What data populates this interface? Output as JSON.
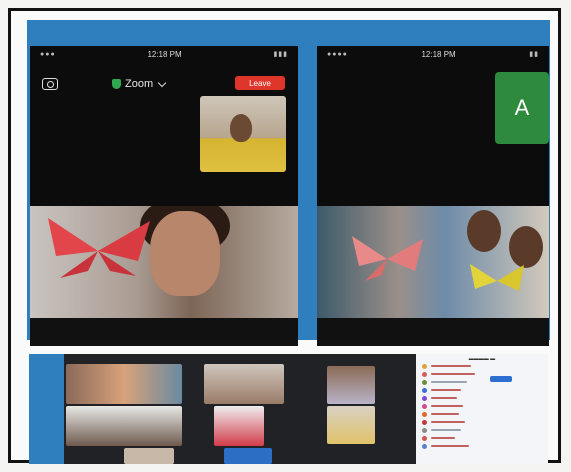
{
  "left_phone": {
    "status_time": "12:18 PM",
    "meeting_title": "Zoom",
    "leave_label": "Leave"
  },
  "right_phone": {
    "status_time": "12:18 PM",
    "avatar_letter": "A"
  },
  "colors": {
    "collage_border": "#2f7fbe",
    "leave_button": "#e0352b",
    "avatar_tile": "#2e8a3c",
    "butterfly_red": "#e2454a",
    "butterfly_yellow": "#e3d33a"
  },
  "icons": [
    "camera-switch-icon",
    "shield-icon",
    "chevron-down-icon"
  ]
}
